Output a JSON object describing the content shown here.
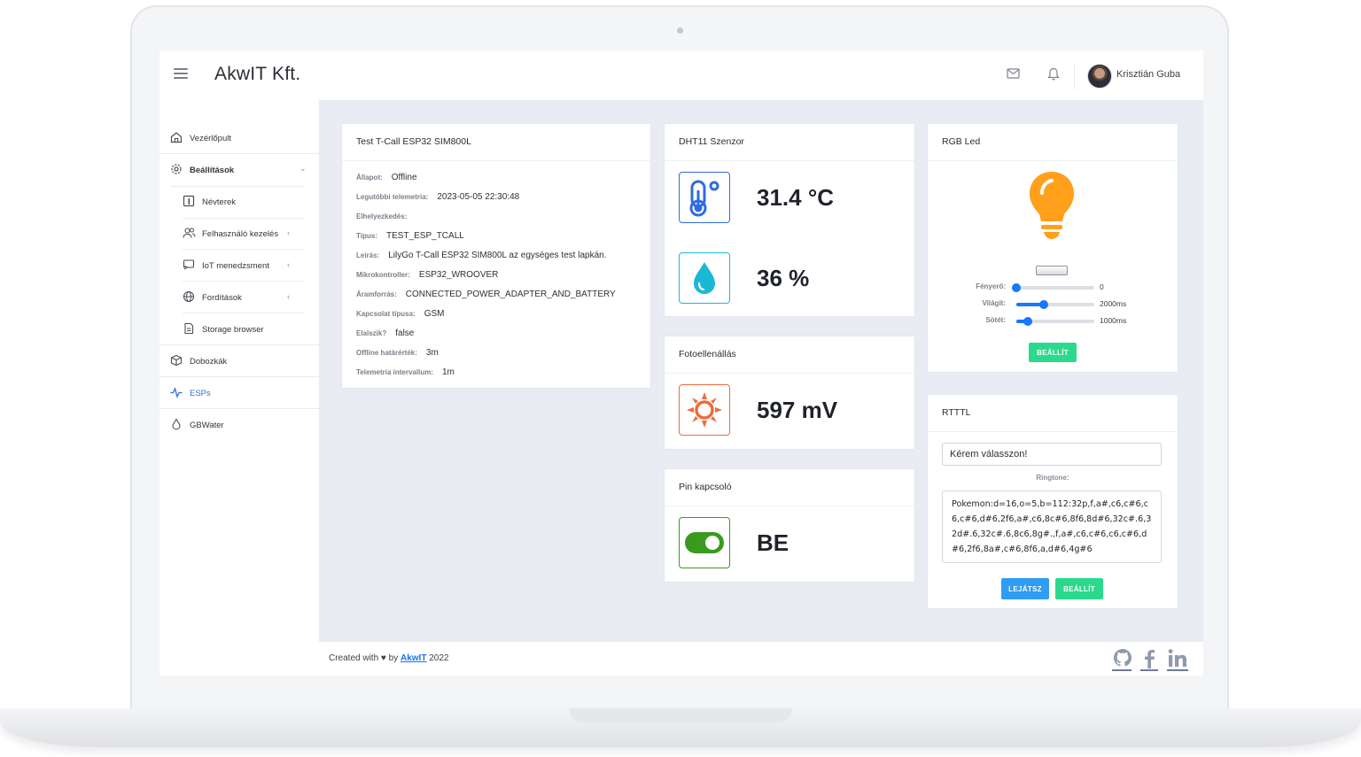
{
  "header": {
    "brand": "AkwIT Kft.",
    "user_name": "Krisztián Guba"
  },
  "sidebar": {
    "items": [
      {
        "label": "Vezérlőpult",
        "icon": "home-icon"
      },
      {
        "label": "Beállítások",
        "icon": "gear-icon"
      },
      {
        "label": "Névterek",
        "icon": "namespace-icon"
      },
      {
        "label": "Felhasználó kezelés",
        "icon": "users-icon"
      },
      {
        "label": "IoT menedzsment",
        "icon": "iot-icon"
      },
      {
        "label": "Fordítások",
        "icon": "globe-icon"
      },
      {
        "label": "Storage browser",
        "icon": "file-icon"
      },
      {
        "label": "Dobozkák",
        "icon": "box-icon"
      },
      {
        "label": "ESPs",
        "icon": "pulse-icon"
      },
      {
        "label": "GBWater",
        "icon": "drop-icon"
      }
    ]
  },
  "device": {
    "title": "Test T-Call ESP32 SIM800L",
    "rows": [
      {
        "key": "Állapot:",
        "value": "Offline"
      },
      {
        "key": "Legutóbbi telemetria:",
        "value": "2023-05-05 22:30:48"
      },
      {
        "key": "Elhelyezkedés:",
        "value": ""
      },
      {
        "key": "Típus:",
        "value": "TEST_ESP_TCALL"
      },
      {
        "key": "Leírás:",
        "value": "LilyGo T-Call ESP32 SIM800L az egységes test lapkán."
      },
      {
        "key": "Mikrokontroller:",
        "value": "ESP32_WROOVER"
      },
      {
        "key": "Áramforrás:",
        "value": "CONNECTED_POWER_ADAPTER_AND_BATTERY"
      },
      {
        "key": "Kapcsolat típusa:",
        "value": "GSM"
      },
      {
        "key": "Elalszik?",
        "value": "false"
      },
      {
        "key": "Offline határérték:",
        "value": "3m"
      },
      {
        "key": "Telemetria intervallum:",
        "value": "1m"
      }
    ]
  },
  "dht": {
    "title": "DHT11 Szenzor",
    "temperature": "31.4 °C",
    "humidity": "36 %",
    "temp_color": "#2f6be0",
    "humidity_color": "#1bb8d6"
  },
  "photo": {
    "title": "Fotoellenállás",
    "value": "597 mV",
    "icon_color": "#f06a3a"
  },
  "pin": {
    "title": "Pin kapcsoló",
    "value": "BE",
    "toggle_on": true,
    "toggle_color": "#3a9a1e"
  },
  "rgb": {
    "title": "RGB Led",
    "bulb_color": "#ff9f1a",
    "sliders": [
      {
        "label": "Fényerő:",
        "value": "0",
        "fraction": 0.0
      },
      {
        "label": "Világít:",
        "value": "2000ms",
        "fraction": 0.35
      },
      {
        "label": "Sötét:",
        "value": "1000ms",
        "fraction": 0.15
      }
    ],
    "set_button": "BEÁLLÍT"
  },
  "rtttl": {
    "title": "RTTTL",
    "select_value": "Kérem válasszon!",
    "ringtone_label": "Ringtone:",
    "ringtone": "Pokemon:d=16,o=5,b=112:32p,f,a#,c6,c#6,c6,c#6,d#6,2f6,a#,c6,8c#6,8f6,8d#6,32c#.6,32d#.6,32c#.6,8c6,8g#.,f,a#,c6,c#6,c6,c#6,d#6,2f6,8a#,c#6,8f6,a,d#6,4g#6",
    "play_button": "LEJÁTSZ",
    "set_button": "BEÁLLÍT"
  },
  "footer": {
    "prefix": "Created with",
    "by": "by",
    "link": "AkwIT",
    "year": "2022"
  }
}
